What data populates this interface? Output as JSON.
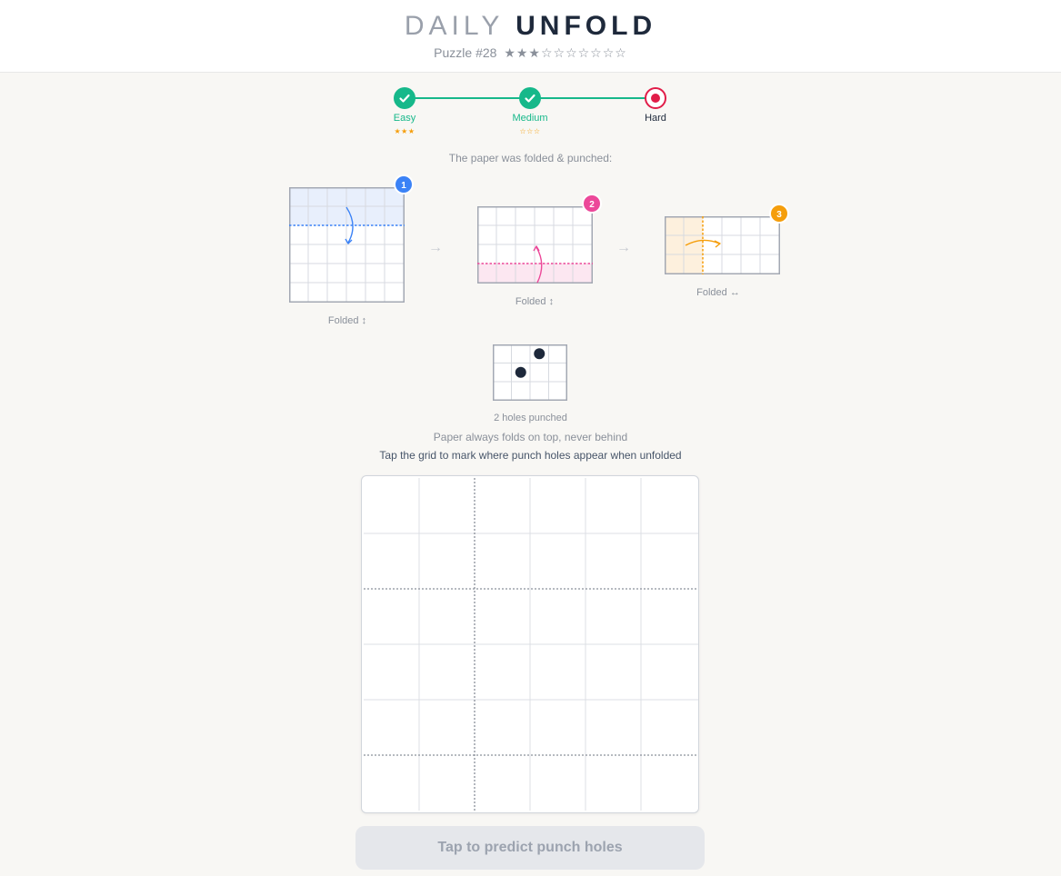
{
  "header": {
    "title_light": "DAILY",
    "title_bold": "UNFOLD",
    "puzzle_label": "Puzzle #28",
    "rating_stars": "★★★☆☆☆☆☆☆☆"
  },
  "stepper": [
    {
      "label": "Easy",
      "stars": "★★★",
      "state": "done"
    },
    {
      "label": "Medium",
      "stars": "☆☆☆",
      "state": "done"
    },
    {
      "label": "Hard",
      "stars": "",
      "state": "current"
    }
  ],
  "intro_text": "The paper was folded & punched:",
  "folds": [
    {
      "step": "1",
      "caption": "Folded ↕",
      "color": "#3b82f6",
      "fill": "#e8effc"
    },
    {
      "step": "2",
      "caption": "Folded ↕",
      "color": "#ec4899",
      "fill": "#fce7f1"
    },
    {
      "step": "3",
      "caption": "Folded ↔",
      "color": "#f59e0b",
      "fill": "#fdf0dd"
    }
  ],
  "punch": {
    "caption": "2 holes punched",
    "holes": [
      {
        "row": 0,
        "col": 2
      },
      {
        "row": 1,
        "col": 1
      }
    ]
  },
  "rule_text": "Paper always folds on top, never behind",
  "task_text": "Tap the grid to mark where punch holes appear when unfolded",
  "answer_grid": {
    "rows": 6,
    "cols": 6
  },
  "predict_button_label": "Tap to predict punch holes",
  "colors": {
    "accent_green": "#16b88a",
    "current_red": "#e11d48",
    "star_gold": "#f59e0b"
  }
}
